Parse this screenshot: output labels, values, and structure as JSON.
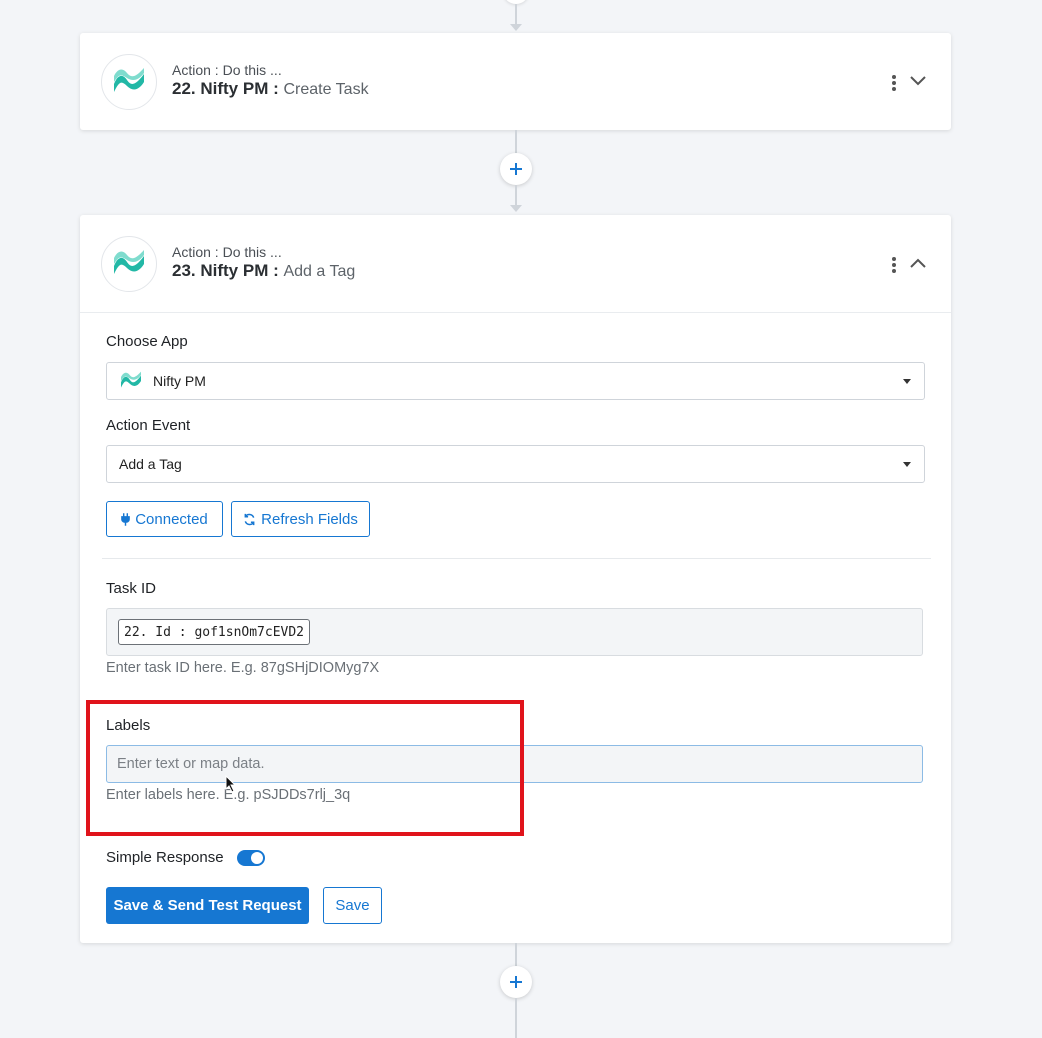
{
  "flow": {
    "card22": {
      "subtitle": "Action : Do this ...",
      "title_prefix": "22. Nifty PM :",
      "action_name": "Create Task"
    },
    "card23": {
      "subtitle": "Action : Do this ...",
      "title_prefix": "23. Nifty PM :",
      "action_name": "Add a Tag",
      "choose_app_label": "Choose App",
      "choose_app_value": "Nifty PM",
      "action_event_label": "Action Event",
      "action_event_value": "Add a Tag",
      "connected_label": "Connected",
      "refresh_label": "Refresh Fields",
      "task_id_label": "Task ID",
      "task_id_chip": "22. Id : gof1snOm7cEVD2",
      "task_id_hint": "Enter task ID here. E.g. 87gSHjDIOMyg7X",
      "labels_label": "Labels",
      "labels_placeholder": "Enter text or map data.",
      "labels_hint": "Enter labels here. E.g. pSJDDs7rlj_3q",
      "simple_response_label": "Simple Response",
      "simple_response_on": true,
      "save_send_label": "Save & Send Test Request",
      "save_label": "Save"
    }
  },
  "icons": {
    "app_logo": "nifty-pm-logo",
    "more": "kebab-icon",
    "collapse": "chevron-up-icon",
    "expand": "chevron-down-icon",
    "add": "plus-icon",
    "plug": "plug-icon",
    "refresh": "refresh-icon"
  },
  "colors": {
    "accent": "#1677d2",
    "highlight": "#e0131b",
    "logo_teal": "#22b8a6"
  }
}
